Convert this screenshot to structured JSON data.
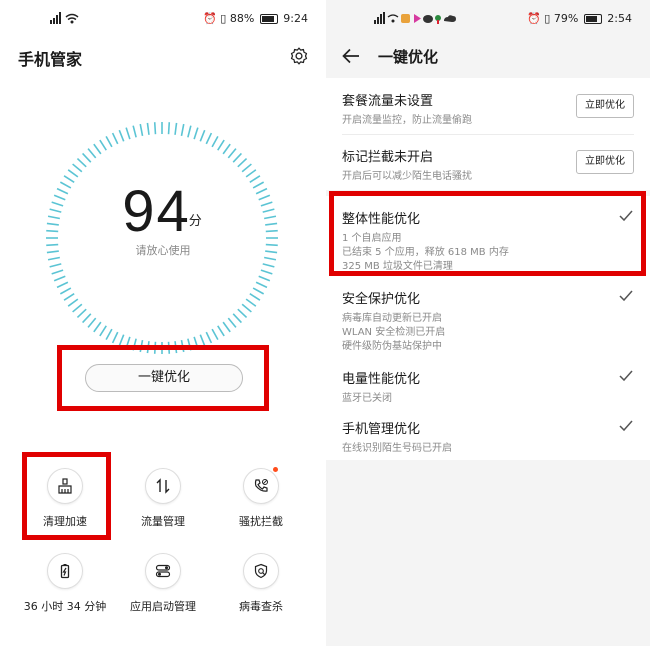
{
  "left": {
    "status": {
      "signal": "²².ıl",
      "battery_text": "88%",
      "time": "9:24",
      "battery_level": 0.88
    },
    "app_title": "手机管家",
    "score": "94",
    "score_unit": "分",
    "score_sub": "请放心使用",
    "optimize_button": "一键优化",
    "tools": [
      {
        "label": "清理加速",
        "icon": "broom-icon"
      },
      {
        "label": "流量管理",
        "icon": "data-transfer-icon"
      },
      {
        "label": "骚扰拦截",
        "icon": "phone-block-icon"
      },
      {
        "label": "36 小时 34 分钟",
        "icon": "battery-icon"
      },
      {
        "label": "应用启动管理",
        "icon": "app-launch-icon"
      },
      {
        "label": "病毒查杀",
        "icon": "virus-scan-icon"
      }
    ]
  },
  "right": {
    "status": {
      "battery_text": "79%",
      "time": "2:54",
      "battery_level": 0.79
    },
    "title": "一键优化",
    "action_items": [
      {
        "title": "套餐流量未设置",
        "sub": "开启流量监控，防止流量偷跑",
        "button": "立即优化"
      },
      {
        "title": "标记拦截未开启",
        "sub": "开启后可以减少陌生电话骚扰",
        "button": "立即优化"
      }
    ],
    "done_items": [
      {
        "title": "整体性能优化",
        "lines": [
          "1 个自启应用",
          "已结束 5 个应用，释放 618 MB 内存",
          "325 MB 垃圾文件已清理"
        ]
      },
      {
        "title": "安全保护优化",
        "lines": [
          "病毒库自动更新已开启",
          "WLAN 安全检测已开启",
          "硬件级防伪基站保护中"
        ]
      },
      {
        "title": "电量性能优化",
        "lines": [
          "蓝牙已关闭"
        ]
      },
      {
        "title": "手机管理优化",
        "lines": [
          "在线识别陌生号码已开启"
        ]
      }
    ]
  },
  "colors": {
    "gauge": "#5bc4d4",
    "highlight": "#e00000",
    "badge": "#ff4d1c"
  }
}
